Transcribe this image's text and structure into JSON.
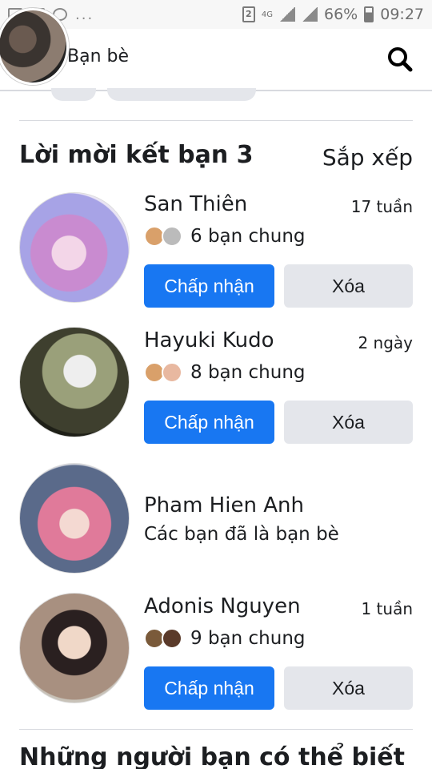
{
  "status_bar": {
    "sim_slot": "2",
    "network": "4G",
    "battery": "66%",
    "time": "09:27"
  },
  "header": {
    "title": "Bạn bè",
    "search_icon": "search-icon"
  },
  "requests": {
    "title": "Lời mời kết bạn 3",
    "sort_label": "Sắp xếp",
    "items": [
      {
        "name": "San Thiên",
        "time": "17 tuần",
        "mutual": "6 bạn chung",
        "accept": "Chấp nhận",
        "delete": "Xóa"
      },
      {
        "name": "Hayuki Kudo",
        "time": "2 ngày",
        "mutual": "8 bạn chung",
        "accept": "Chấp nhận",
        "delete": "Xóa"
      },
      {
        "name": "Pham Hien Anh",
        "status": "Các bạn đã là bạn bè"
      },
      {
        "name": "Adonis Nguyen",
        "time": "1 tuần",
        "mutual": "9 bạn chung",
        "accept": "Chấp nhận",
        "delete": "Xóa"
      }
    ]
  },
  "suggestions": {
    "title": "Những người bạn có thể biết"
  },
  "colors": {
    "accent": "#1877f2",
    "secondary_button": "#e4e6eb",
    "text": "#1c1e21"
  }
}
